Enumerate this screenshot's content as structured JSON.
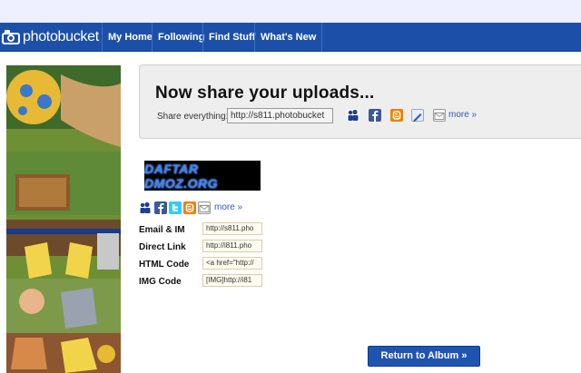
{
  "header": {
    "logo_text": "photobucket",
    "nav": [
      {
        "label": "My Home"
      },
      {
        "label": "Following"
      },
      {
        "label": "Find Stuff"
      },
      {
        "label": "What's New"
      }
    ]
  },
  "share_panel": {
    "title": "Now share your uploads...",
    "everything_label": "Share everything:",
    "everything_url": "http://s811.photobucket",
    "more_label": "more »"
  },
  "image": {
    "banner_text": "DAFTAR DMOZ.ORG",
    "more_label": "more »"
  },
  "codes": [
    {
      "label": "Email & IM",
      "value": "http://s811.pho"
    },
    {
      "label": "Direct Link",
      "value": "http://i811.pho"
    },
    {
      "label": "HTML Code",
      "value": "<a href=\"http://"
    },
    {
      "label": "IMG Code",
      "value": "[IMG]http://i81"
    }
  ],
  "return_button": "Return to Album »",
  "icons": [
    "myspace-icon",
    "facebook-icon",
    "blogger-icon",
    "bookmark-icon",
    "email-icon",
    "twitter-icon"
  ],
  "colors": {
    "nav_bg": "#1c50a8",
    "accent_link": "#2a5bc4",
    "blogger": "#f57d00",
    "facebook": "#3b5998"
  }
}
